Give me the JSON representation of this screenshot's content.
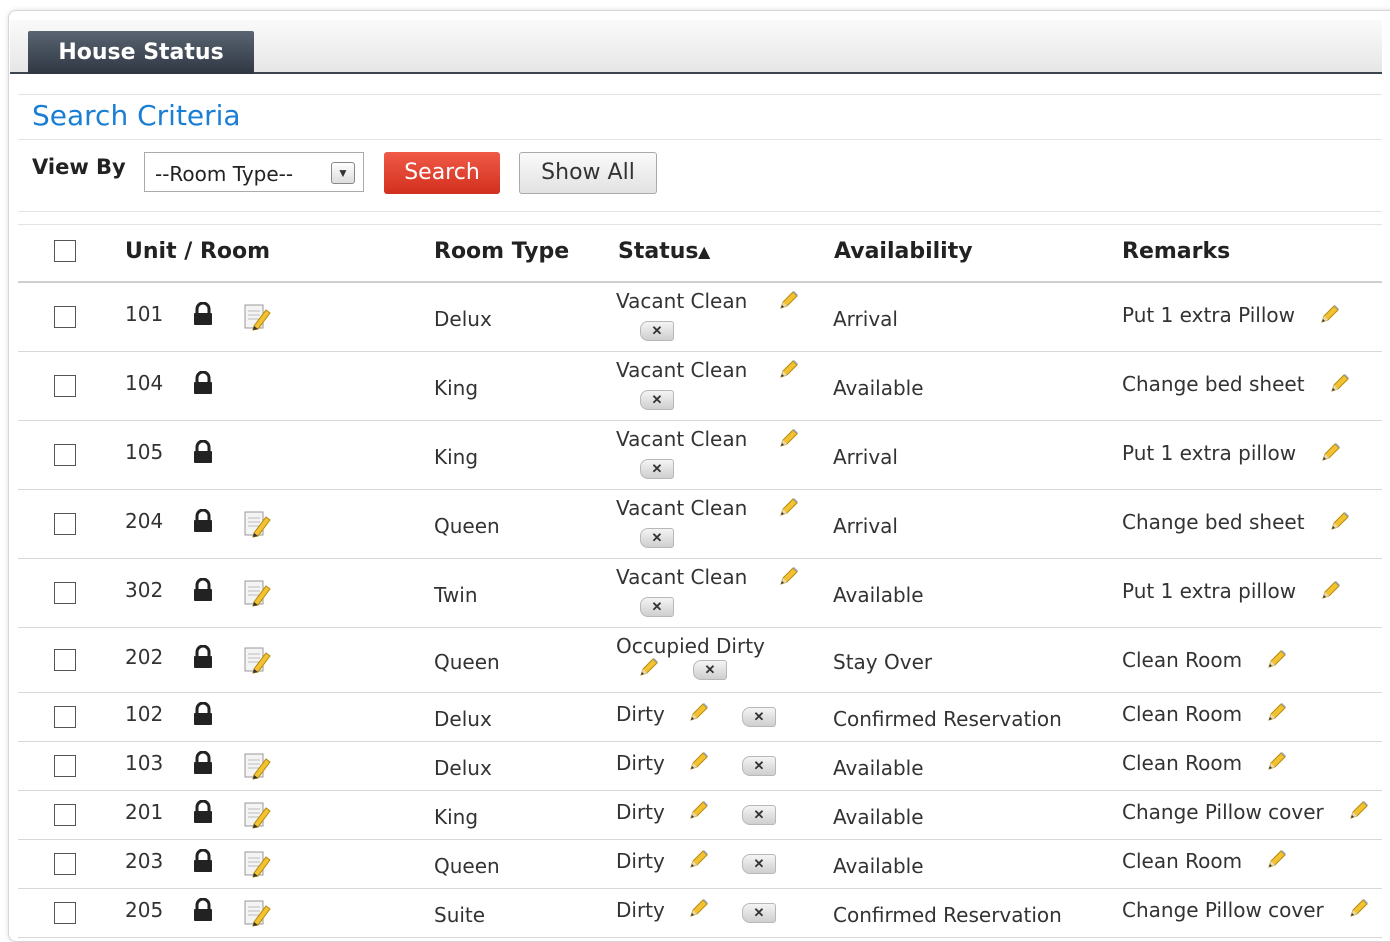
{
  "tab": {
    "label": "House Status"
  },
  "criteria": {
    "title": "Search Criteria",
    "view_by_label": "View By",
    "room_type_select": "--Room Type--",
    "search_button": "Search",
    "show_all_button": "Show All"
  },
  "table": {
    "headers": {
      "unit_room": "Unit / Room",
      "room_type": "Room Type",
      "status": "Status",
      "status_sort": "▲",
      "availability": "Availability",
      "remarks": "Remarks"
    },
    "rows": [
      {
        "room": "101",
        "has_note": true,
        "type": "Delux",
        "status": "Vacant Clean",
        "availability": "Arrival",
        "remarks": "Put 1 extra Pillow"
      },
      {
        "room": "104",
        "has_note": false,
        "type": "King",
        "status": "Vacant Clean",
        "availability": "Available",
        "remarks": "Change bed sheet"
      },
      {
        "room": "105",
        "has_note": false,
        "type": "King",
        "status": "Vacant Clean",
        "availability": "Arrival",
        "remarks": "Put 1 extra pillow"
      },
      {
        "room": "204",
        "has_note": true,
        "type": "Queen",
        "status": "Vacant Clean",
        "availability": "Arrival",
        "remarks": "Change bed sheet"
      },
      {
        "room": "302",
        "has_note": true,
        "type": "Twin",
        "status": "Vacant Clean",
        "availability": "Available",
        "remarks": "Put 1 extra pillow"
      },
      {
        "room": "202",
        "has_note": true,
        "type": "Queen",
        "status": "Occupied Dirty",
        "availability": "Stay Over",
        "remarks": "Clean Room"
      },
      {
        "room": "102",
        "has_note": false,
        "type": "Delux",
        "status": "Dirty",
        "availability": "Confirmed Reservation",
        "remarks": "Clean Room"
      },
      {
        "room": "103",
        "has_note": true,
        "type": "Delux",
        "status": "Dirty",
        "availability": "Available",
        "remarks": "Clean Room"
      },
      {
        "room": "201",
        "has_note": true,
        "type": "King",
        "status": "Dirty",
        "availability": "Available",
        "remarks": "Change Pillow cover"
      },
      {
        "room": "203",
        "has_note": true,
        "type": "Queen",
        "status": "Dirty",
        "availability": "Available",
        "remarks": "Clean Room"
      },
      {
        "room": "205",
        "has_note": true,
        "type": "Suite",
        "status": "Dirty",
        "availability": "Confirmed Reservation",
        "remarks": "Change Pillow cover"
      }
    ]
  },
  "icons": {
    "lock": "lock-icon",
    "note": "notepad-icon",
    "edit": "pencil-icon",
    "remove": "remove-x-icon"
  },
  "colors": {
    "accent": "#1a7fd4",
    "search_button": "#e0402e",
    "tab": "#3c4450"
  }
}
